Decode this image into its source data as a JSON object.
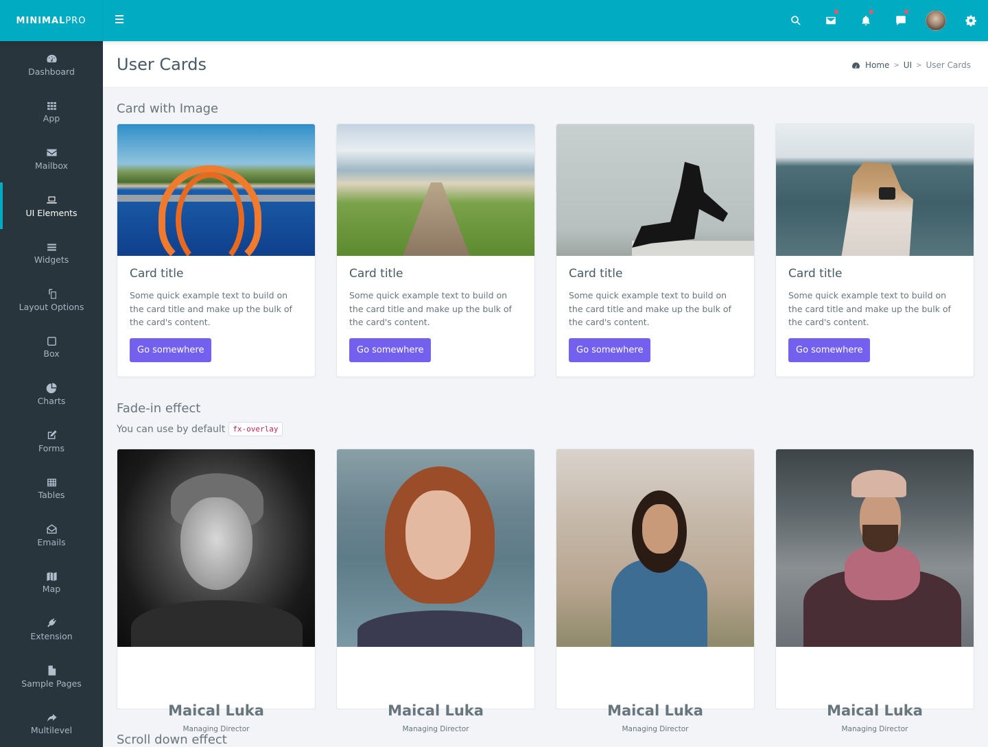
{
  "brand": {
    "bold": "MINIMAL",
    "light": "PRO"
  },
  "header": {
    "icons": [
      {
        "name": "search-icon",
        "badge": false
      },
      {
        "name": "mail-icon",
        "badge": true
      },
      {
        "name": "bell-icon",
        "badge": true
      },
      {
        "name": "chat-icon",
        "badge": true
      },
      {
        "name": "user-avatar",
        "badge": false
      },
      {
        "name": "gear-icon",
        "badge": false
      }
    ],
    "accent_color": "#01abc1",
    "badge_color": "#f4516c"
  },
  "sidebar": {
    "items": [
      {
        "label": "Dashboard",
        "icon": "dashboard-icon",
        "active": false
      },
      {
        "label": "App",
        "icon": "grid-icon",
        "active": false
      },
      {
        "label": "Mailbox",
        "icon": "envelope-icon",
        "active": false
      },
      {
        "label": "UI Elements",
        "icon": "laptop-icon",
        "active": true
      },
      {
        "label": "Widgets",
        "icon": "bars-icon",
        "active": false
      },
      {
        "label": "Layout Options",
        "icon": "clone-icon",
        "active": false
      },
      {
        "label": "Box",
        "icon": "square-icon",
        "active": false
      },
      {
        "label": "Charts",
        "icon": "pie-chart-icon",
        "active": false
      },
      {
        "label": "Forms",
        "icon": "edit-icon",
        "active": false
      },
      {
        "label": "Tables",
        "icon": "table-icon",
        "active": false
      },
      {
        "label": "Emails",
        "icon": "envelope-open-icon",
        "active": false
      },
      {
        "label": "Map",
        "icon": "map-icon",
        "active": false
      },
      {
        "label": "Extension",
        "icon": "plug-icon",
        "active": false
      },
      {
        "label": "Sample Pages",
        "icon": "file-icon",
        "active": false
      },
      {
        "label": "Multilevel",
        "icon": "share-icon",
        "active": false
      }
    ]
  },
  "page": {
    "title": "User Cards",
    "breadcrumb": [
      "Home",
      "UI",
      "User Cards"
    ]
  },
  "section1": {
    "title": "Card with Image",
    "cards": [
      {
        "image": "orange-rope-on-boat-rail",
        "title": "Card title",
        "text": "Some quick example text to build on the card title and make up the bulk of the card's content.",
        "button": "Go somewhere"
      },
      {
        "image": "wooden-boardwalk-to-beach",
        "title": "Card title",
        "text": "Some quick example text to build on the card title and make up the bulk of the card's content.",
        "button": "Go somewhere"
      },
      {
        "image": "woman-sitting-on-ledge",
        "title": "Card title",
        "text": "Some quick example text to build on the card title and make up the bulk of the card's content.",
        "button": "Go somewhere"
      },
      {
        "image": "woman-with-camera-by-sea",
        "title": "Card title",
        "text": "Some quick example text to build on the card title and make up the bulk of the card's content.",
        "button": "Go somewhere"
      }
    ],
    "button_color": "#7460ee"
  },
  "section2": {
    "title": "Fade-in effect",
    "subtitle": "You can use by default",
    "code": "fx-overlay",
    "users": [
      {
        "photo": "smiling-man-bw",
        "name": "Maical Luka",
        "role": "Managing Director"
      },
      {
        "photo": "red-haired-woman",
        "name": "Maical Luka",
        "role": "Managing Director"
      },
      {
        "photo": "woman-with-glasses-denim",
        "name": "Maical Luka",
        "role": "Managing Director"
      },
      {
        "photo": "man-with-hat-scarf",
        "name": "Maical Luka",
        "role": "Managing Director"
      }
    ]
  },
  "section3": {
    "title": "Scroll down effect"
  }
}
